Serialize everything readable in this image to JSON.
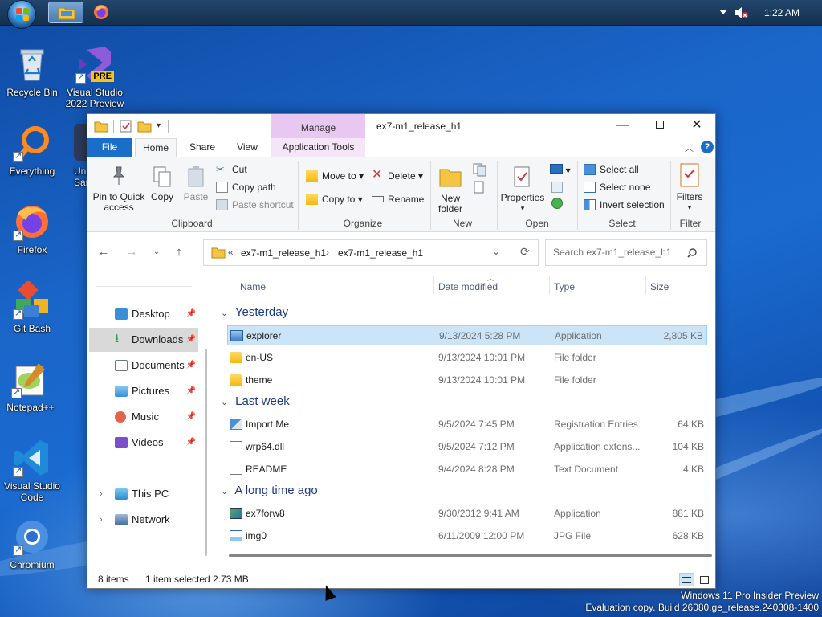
{
  "taskbar": {
    "clock": "1:22 AM"
  },
  "desktop": {
    "icons": [
      {
        "label": "Recycle Bin"
      },
      {
        "label": "Visual Studio 2022 Preview",
        "badge": "PRE"
      },
      {
        "label": "Everything"
      },
      {
        "label": "Un Sand"
      },
      {
        "label": "Firefox"
      },
      {
        "label": "Git Bash"
      },
      {
        "label": "Notepad++"
      },
      {
        "label": "Visual Studio Code"
      },
      {
        "label": "Chromium"
      }
    ]
  },
  "window": {
    "title": "ex7-m1_release_h1",
    "contextual_tab": "Manage",
    "tabs": {
      "file": "File",
      "home": "Home",
      "share": "Share",
      "view": "View",
      "app_tools": "Application Tools"
    },
    "ribbon": {
      "clipboard": {
        "label": "Clipboard",
        "pin": "Pin to Quick access",
        "copy": "Copy",
        "paste": "Paste",
        "cut": "Cut",
        "copy_path": "Copy path",
        "paste_shortcut": "Paste shortcut"
      },
      "organize": {
        "label": "Organize",
        "move_to": "Move to",
        "copy_to": "Copy to",
        "delete": "Delete",
        "rename": "Rename"
      },
      "new": {
        "label": "New",
        "new_folder": "New folder"
      },
      "open": {
        "label": "Open",
        "properties": "Properties"
      },
      "select": {
        "label": "Select",
        "select_all": "Select all",
        "select_none": "Select none",
        "invert": "Invert selection"
      },
      "filter": {
        "label": "Filter",
        "filters": "Filters"
      }
    },
    "address": {
      "crumb_prefix": "«",
      "crumbs": [
        "ex7-m1_release_h1",
        "ex7-m1_release_h1"
      ],
      "search_placeholder": "Search ex7-m1_release_h1"
    },
    "nav": {
      "quick": [
        {
          "label": "Desktop",
          "icon": "desktop-icon",
          "color": "#3a8fd6"
        },
        {
          "label": "Downloads",
          "icon": "download-icon",
          "color": "#2e9e57"
        },
        {
          "label": "Documents",
          "icon": "documents-icon",
          "color": "#6d7b8a"
        },
        {
          "label": "Pictures",
          "icon": "pictures-icon",
          "color": "#3a8fd6"
        },
        {
          "label": "Music",
          "icon": "music-icon",
          "color": "#e2624a"
        },
        {
          "label": "Videos",
          "icon": "videos-icon",
          "color": "#7b4fc9"
        }
      ],
      "this_pc": "This PC",
      "network": "Network"
    },
    "columns": {
      "name": "Name",
      "date": "Date modified",
      "type": "Type",
      "size": "Size"
    },
    "groups": [
      {
        "label": "Yesterday",
        "files": [
          {
            "name": "explorer",
            "date": "9/13/2024 5:28 PM",
            "type": "Application",
            "size": "2,805 KB",
            "icon": "app-icon",
            "selected": true
          },
          {
            "name": "en-US",
            "date": "9/13/2024 10:01 PM",
            "type": "File folder",
            "size": "",
            "icon": "folder-icon"
          },
          {
            "name": "theme",
            "date": "9/13/2024 10:01 PM",
            "type": "File folder",
            "size": "",
            "icon": "folder-icon"
          }
        ]
      },
      {
        "label": "Last week",
        "files": [
          {
            "name": "Import Me",
            "date": "9/5/2024 7:45 PM",
            "type": "Registration Entries",
            "size": "64 KB",
            "icon": "registry-icon"
          },
          {
            "name": "wrp64.dll",
            "date": "9/5/2024 7:12 PM",
            "type": "Application extens...",
            "size": "104 KB",
            "icon": "dll-icon"
          },
          {
            "name": "README",
            "date": "9/4/2024 8:28 PM",
            "type": "Text Document",
            "size": "4 KB",
            "icon": "text-file-icon"
          }
        ]
      },
      {
        "label": "A long time ago",
        "files": [
          {
            "name": "ex7forw8",
            "date": "9/30/2012 9:41 AM",
            "type": "Application",
            "size": "881 KB",
            "icon": "app-icon"
          },
          {
            "name": "img0",
            "date": "6/11/2009 12:00 PM",
            "type": "JPG File",
            "size": "628 KB",
            "icon": "image-file-icon"
          }
        ]
      }
    ],
    "status": {
      "items": "8 items",
      "selected": "1 item selected  2.73 MB"
    }
  },
  "watermark": {
    "line1": "Windows 11 Pro Insider Preview",
    "line2": "Evaluation copy. Build 26080.ge_release.240308-1400"
  }
}
